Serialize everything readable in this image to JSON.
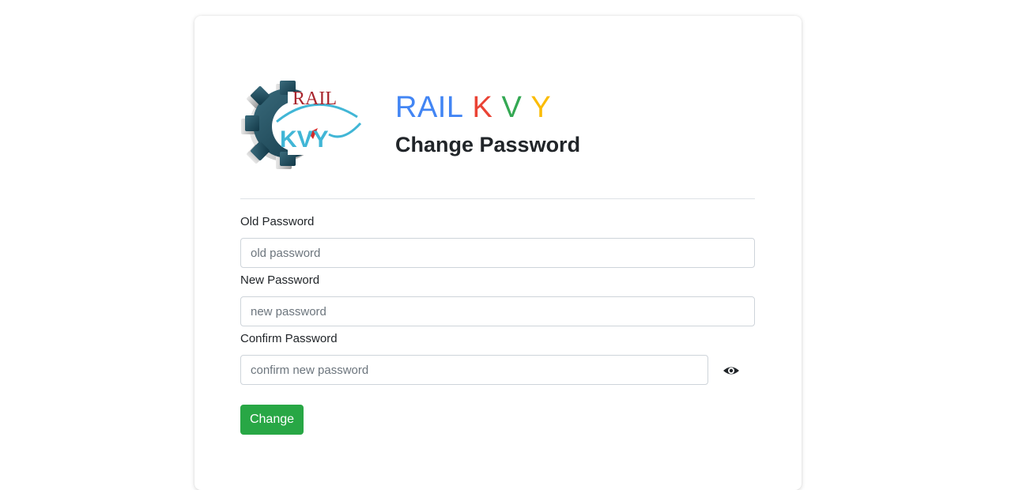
{
  "logo": {
    "text_top": "RAIL",
    "text_bottom": "KVY",
    "icon": "gear-logo-icon"
  },
  "brand": {
    "parts": [
      {
        "text": "RAIL",
        "color": "#4285f4"
      },
      {
        "text": "K",
        "color": "#ea4335"
      },
      {
        "text": "V",
        "color": "#34a853"
      },
      {
        "text": "Y",
        "color": "#fbbc05"
      }
    ]
  },
  "heading": "Change Password",
  "form": {
    "old": {
      "label": "Old Password",
      "placeholder": "old password",
      "value": ""
    },
    "new": {
      "label": "New Password",
      "placeholder": "new password",
      "value": ""
    },
    "confirm": {
      "label": "Confirm Password",
      "placeholder": "confirm new password",
      "value": ""
    },
    "toggle_icon": "eye-icon",
    "submit_label": "Change"
  },
  "colors": {
    "submit": "#28a745",
    "gear": "#1f4e5f",
    "logo_red": "#a8242c",
    "logo_blue": "#41b6d6"
  }
}
